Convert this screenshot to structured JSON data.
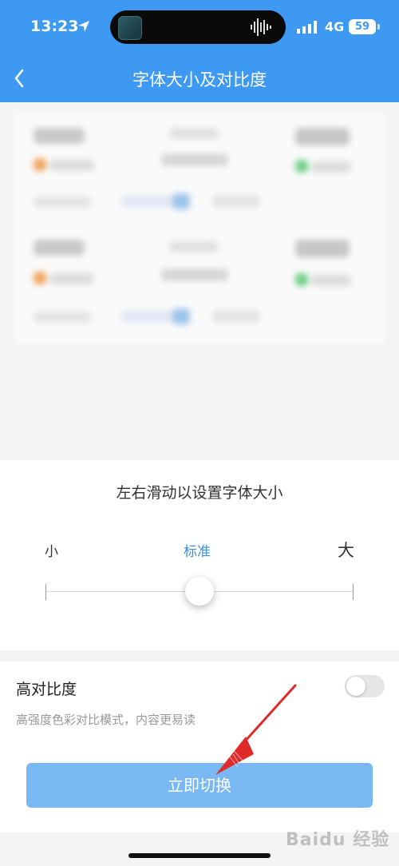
{
  "status_bar": {
    "time": "13:23",
    "network": "4G",
    "battery": "59",
    "icons": [
      "location-arrow-icon",
      "signal-bars-icon",
      "battery-icon",
      "audio-wave-icon"
    ]
  },
  "nav": {
    "title": "字体大小及对比度",
    "back_icon": "chevron-left-icon"
  },
  "font_size": {
    "instruction": "左右滑动以设置字体大小",
    "small_label": "小",
    "standard_label": "标准",
    "large_label": "大",
    "slider_level": 0.5
  },
  "contrast": {
    "title": "高对比度",
    "description": "高强度色彩对比模式，内容更易读",
    "enabled": false
  },
  "action": {
    "switch_label": "立即切换"
  },
  "watermark_text": "Baidu 经验",
  "colors": {
    "brand_blue": "#3d99f2",
    "button_blue": "#7ab8f4",
    "arrow_red": "#e02a2a"
  }
}
